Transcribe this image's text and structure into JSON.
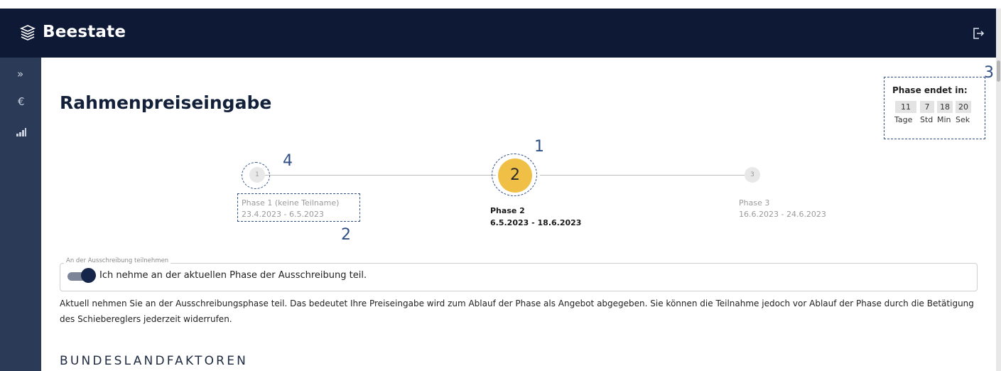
{
  "header": {
    "app_title": "Beestate",
    "logo_icon": "stacked-layers-icon",
    "logout_icon": "logout-icon"
  },
  "sidebar": {
    "items": [
      {
        "icon": "chevron-double-right-icon",
        "glyph": "»"
      },
      {
        "icon": "euro-icon",
        "glyph": "€"
      },
      {
        "icon": "bar-chart-icon",
        "glyph": ""
      }
    ]
  },
  "page": {
    "title": "Rahmenpreiseingabe"
  },
  "timer": {
    "label": "Phase endet in:",
    "values": [
      "11",
      "7",
      "18",
      "20"
    ],
    "units": [
      "Tage",
      "Std",
      "Min",
      "Sek"
    ]
  },
  "stepper": {
    "steps": [
      {
        "number": "1",
        "name": "Phase 1 (keine Teilname)",
        "dates": "23.4.2023 - 6.5.2023",
        "state": "done"
      },
      {
        "number": "2",
        "name": "Phase 2",
        "dates": "6.5.2023 - 18.6.2023",
        "state": "active"
      },
      {
        "number": "3",
        "name": "Phase 3",
        "dates": "16.6.2023 - 24.6.2023",
        "state": "upcoming"
      }
    ]
  },
  "annotations": {
    "a1": "1",
    "a2": "2",
    "a3": "3",
    "a4": "4"
  },
  "participation": {
    "legend": "An der Ausschreibung teilnehmen",
    "toggle_on": true,
    "label": "Ich nehme an der aktuellen Phase der Ausschreibung teil.",
    "info": "Aktuell nehmen Sie an der Ausschreibungsphase teil. Das bedeutet Ihre Preiseingabe wird zum Ablauf der Phase als Angebot abgegeben. Sie können die Teilnahme jedoch vor Ablauf der Phase durch die Betätigung des Schiebereglers jederzeit widerrufen."
  },
  "section": {
    "heading": "BUNDESLANDFAKTOREN"
  },
  "colors": {
    "header_bg": "#0e1936",
    "sidebar_bg": "#2b3a56",
    "accent": "#f0bf45",
    "annotation": "#2f4f86"
  }
}
